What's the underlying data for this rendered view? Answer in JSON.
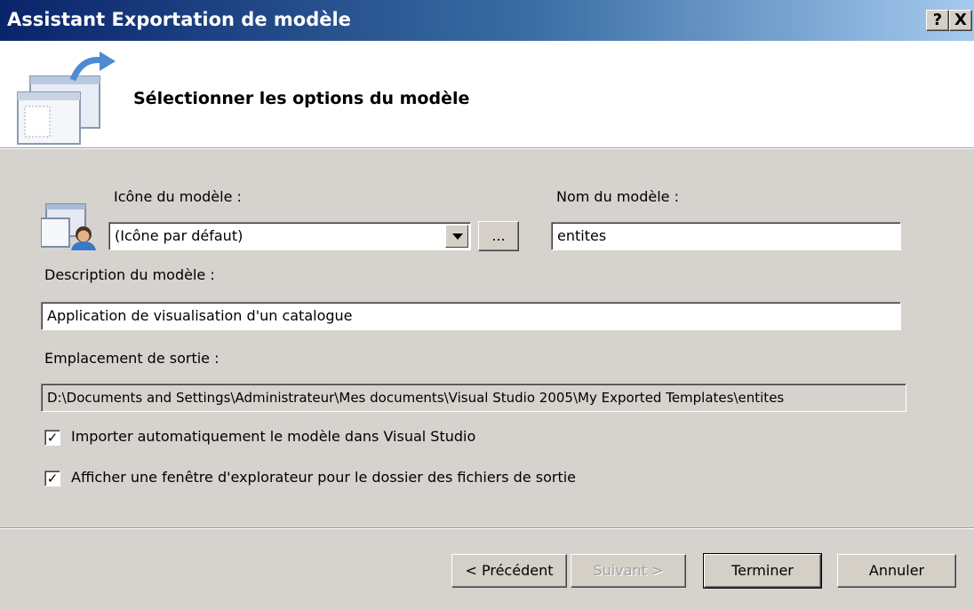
{
  "window": {
    "title": "Assistant Exportation de modèle",
    "help_label": "?",
    "close_label": "X"
  },
  "header": {
    "title": "Sélectionner les options du modèle"
  },
  "form": {
    "icon_label": "Icône du modèle :",
    "icon_value": "(Icône par défaut)",
    "browse_label": "...",
    "name_label": "Nom du modèle :",
    "name_value": "entites",
    "description_label": "Description du modèle :",
    "description_value": "Application de visualisation d'un catalogue",
    "output_label": "Emplacement de sortie :",
    "output_value": "D:\\Documents and Settings\\Administrateur\\Mes documents\\Visual Studio 2005\\My Exported Templates\\entites",
    "import_checkbox": {
      "checked": true,
      "label": "Importer automatiquement le modèle dans Visual Studio"
    },
    "explorer_checkbox": {
      "checked": true,
      "label": "Afficher une fenêtre d'explorateur pour le dossier des fichiers de sortie"
    }
  },
  "buttons": {
    "previous": "< Précédent",
    "next": "Suivant >",
    "finish": "Terminer",
    "cancel": "Annuler"
  },
  "colors": {
    "titlebar_start": "#0a246a",
    "titlebar_end": "#a6caf0",
    "dialog_bg": "#d6d3ce"
  }
}
